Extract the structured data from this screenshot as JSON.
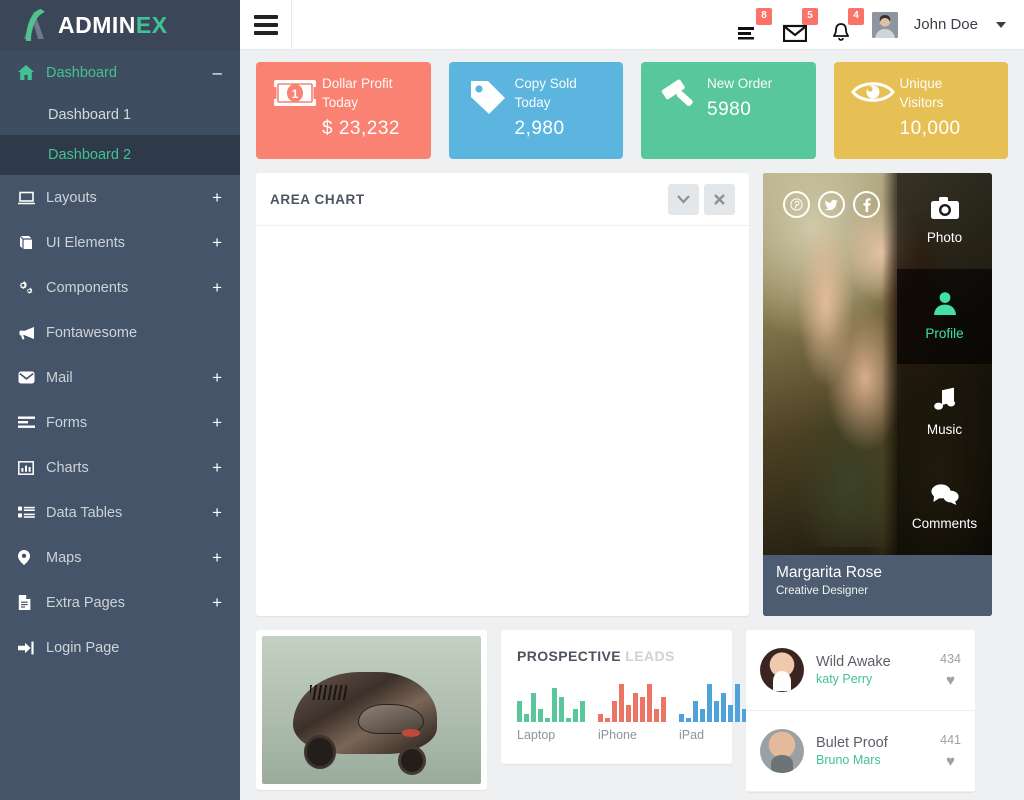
{
  "brand": {
    "name_white": "ADMIN",
    "name_green": "EX",
    "accent": "#42c294",
    "sidebar_bg": "#455468"
  },
  "header": {
    "hamburger_icon": "hamburger-icon",
    "username": "John Doe",
    "icons": [
      {
        "name": "tasks-icon",
        "glyph": "tasks",
        "badge": "8"
      },
      {
        "name": "envelope-icon",
        "glyph": "envelope",
        "badge": "5"
      },
      {
        "name": "bell-icon",
        "glyph": "bell",
        "badge": "4"
      }
    ],
    "badge_color": "#fa7268"
  },
  "sidebar": {
    "items": [
      {
        "label": "Dashboard",
        "icon": "home-icon",
        "toggle": "–",
        "active": true
      },
      {
        "label": "Layouts",
        "icon": "laptop-icon",
        "toggle": "+"
      },
      {
        "label": "UI Elements",
        "icon": "book-icon",
        "toggle": "+"
      },
      {
        "label": "Components",
        "icon": "gears-icon",
        "toggle": "+"
      },
      {
        "label": "Fontawesome",
        "icon": "bullhorn-icon",
        "toggle": ""
      },
      {
        "label": "Mail",
        "icon": "envelope-icon",
        "toggle": "+"
      },
      {
        "label": "Forms",
        "icon": "form-lines-icon",
        "toggle": "+"
      },
      {
        "label": "Charts",
        "icon": "bar-chart-icon",
        "toggle": "+"
      },
      {
        "label": "Data Tables",
        "icon": "list-icon",
        "toggle": "+"
      },
      {
        "label": "Maps",
        "icon": "map-pin-icon",
        "toggle": "+"
      },
      {
        "label": "Extra Pages",
        "icon": "file-icon",
        "toggle": "+"
      },
      {
        "label": "Login Page",
        "icon": "sign-in-icon",
        "toggle": ""
      }
    ],
    "sub_items": [
      {
        "label": "Dashboard 1",
        "active": false
      },
      {
        "label": "Dashboard 2",
        "active": true
      }
    ]
  },
  "stats": [
    {
      "label_line1": "Dollar Profit",
      "label_line2": "Today",
      "value": "$ 23,232",
      "color": "#f98273",
      "icon": "money-bill-icon"
    },
    {
      "label_line1": "Copy Sold",
      "label_line2": "Today",
      "value": "2,980",
      "color": "#5bb5de",
      "icon": "tag-icon"
    },
    {
      "label_line1": "New Order",
      "label_line2": "",
      "value": "5980",
      "color": "#58c79b",
      "icon": "gavel-icon"
    },
    {
      "label_line1": "Unique",
      "label_line2": "Visitors",
      "value": "10,000",
      "color": "#e6c055",
      "icon": "eye-icon"
    }
  ],
  "chart_panel": {
    "title": "AREA CHART",
    "tools": [
      {
        "name": "collapse-button",
        "glyph": "∨"
      },
      {
        "name": "close-button",
        "glyph": "×"
      }
    ]
  },
  "profile_card": {
    "name": "Margarita Rose",
    "role": "Creative Designer",
    "social": [
      {
        "name": "pinterest-icon",
        "glyph": "Ⓟ"
      },
      {
        "name": "twitter-icon",
        "glyph": "ᵗ"
      },
      {
        "name": "facebook-icon",
        "glyph": "f"
      }
    ],
    "menu": [
      {
        "label": "Photo",
        "icon": "camera-icon",
        "glyph": "▣",
        "selected": false
      },
      {
        "label": "Profile",
        "icon": "user-icon",
        "glyph": "●",
        "selected": true
      },
      {
        "label": "Music",
        "icon": "music-icon",
        "glyph": "♫",
        "selected": false
      },
      {
        "label": "Comments",
        "icon": "comments-icon",
        "glyph": "●",
        "selected": false
      }
    ]
  },
  "image_panel": {
    "alt": "concept-vehicle-photo"
  },
  "leads_panel": {
    "title_strong": "PROSPECTIVE",
    "title_light": "LEADS"
  },
  "chart_data": {
    "type": "bar",
    "title": "PROSPECTIVE LEADS",
    "xlabel": "",
    "ylabel": "",
    "grid": false,
    "legend": "none",
    "ylim": [
      0,
      10
    ],
    "series": [
      {
        "name": "Laptop",
        "color": "#58c79b",
        "values": [
          5,
          2,
          7,
          3,
          1,
          8,
          6,
          1,
          3,
          5
        ]
      },
      {
        "name": "iPhone",
        "color": "#ec7465",
        "values": [
          2,
          1,
          5,
          9,
          4,
          7,
          6,
          9,
          3,
          6
        ]
      },
      {
        "name": "iPad",
        "color": "#4fa3d8",
        "values": [
          2,
          1,
          5,
          3,
          9,
          5,
          7,
          4,
          9,
          3,
          7
        ]
      }
    ],
    "categories": [
      "Laptop",
      "iPhone",
      "iPad"
    ]
  },
  "music_panel": {
    "rows": [
      {
        "title": "Wild Awake",
        "artist": "katy Perry",
        "count": "434",
        "avatar": "f",
        "heart": "♥"
      },
      {
        "title": "Bulet Proof",
        "artist": "Bruno Mars",
        "count": "441",
        "avatar": "m",
        "heart": "♥"
      }
    ]
  }
}
